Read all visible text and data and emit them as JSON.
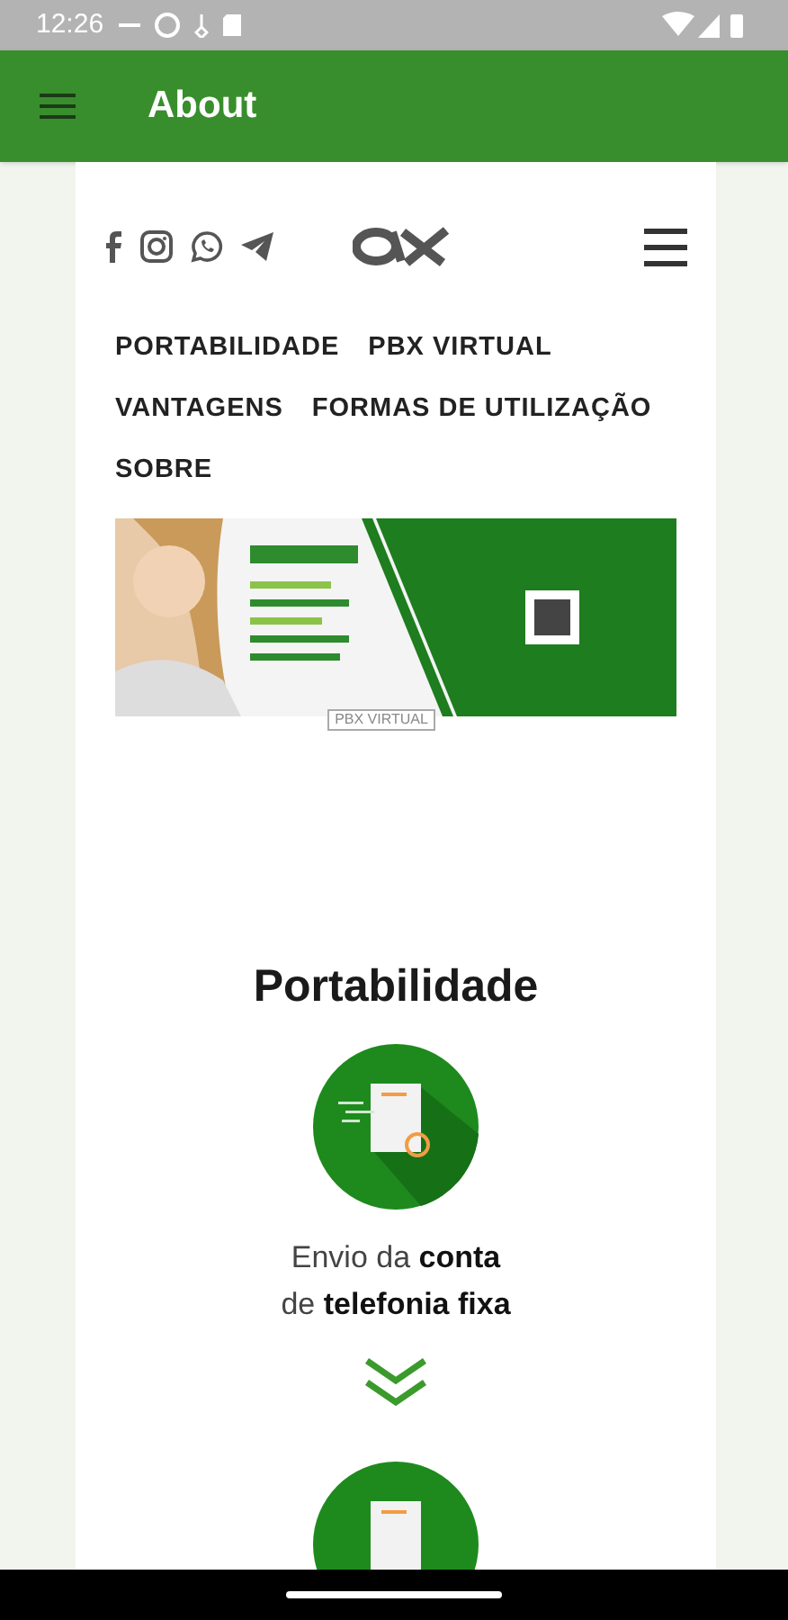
{
  "status_bar": {
    "time": "12:26"
  },
  "app_bar": {
    "title": "About"
  },
  "nav_links": [
    "PORTABILIDADE",
    "PBX VIRTUAL",
    "VANTAGENS",
    "FORMAS DE UTILIZAÇÃO",
    "SOBRE"
  ],
  "banner": {
    "kind": "picture",
    "caption": "PBX VIRTUAL"
  },
  "section": {
    "title": "Portabilidade",
    "steps": [
      {
        "text": "Envio da **conta**\nde **telefonia fixa**"
      }
    ]
  }
}
